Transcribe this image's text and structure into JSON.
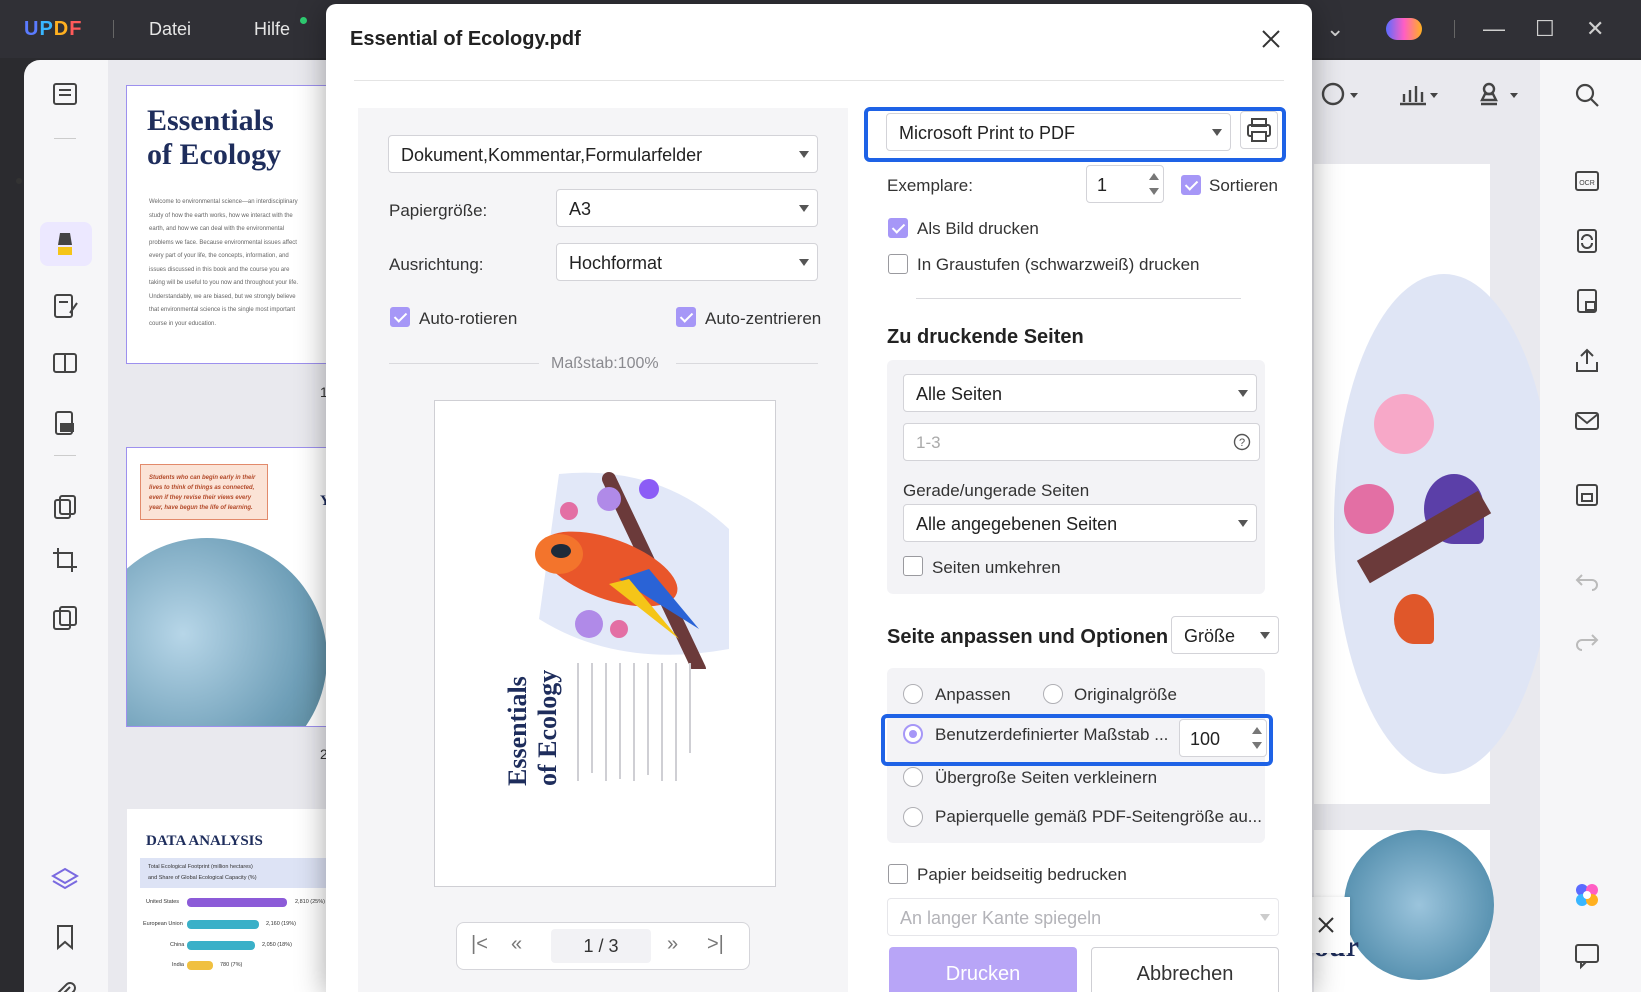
{
  "app": {
    "menu_file": "Datei",
    "menu_help": "Hilfe",
    "accent": "#a697f7",
    "highlight_color": "#1e62e6"
  },
  "background": {
    "thumb1_title_line1": "Essentials",
    "thumb1_title_line2": "of Ecology",
    "thumb1_body": "Welcome to environmental science—an interdisciplinary study of how the earth works, how we interact with the earth, and how we can deal with the environmental problems we face. Because environmental issues affect every part of your life, the concepts, information, and issues discussed in this book and the course you are taking will be useful to you now and throughout your life. Understandably, we are biased, but we strongly believe that environmental science is the single most important course in your education.",
    "page1": "1",
    "page2": "2",
    "callout": "Students who can begin early in their lives to think of things as connected, even if they revise their views every year, have begun the life of learning.",
    "thumb2_letter": "Y",
    "data_title": "DATA ANALYSIS",
    "data_legend_line1": "Total Ecological Footprint (million hectares)",
    "data_legend_line2": "and Share of Global Ecological Capacity (%)",
    "data_rows": [
      {
        "label": "United States",
        "value": "2,810 (25%)"
      },
      {
        "label": "European Union",
        "value": "2,160 (19%)"
      },
      {
        "label": "China",
        "value": "2,050 (18%)"
      },
      {
        "label": "India",
        "value": "780 (7%)"
      }
    ],
    "right_fragment": "our"
  },
  "dialog": {
    "title": "Essential of Ecology.pdf",
    "content_select": "Dokument,Kommentar,Formularfelder",
    "paper_size_label": "Papiergröße:",
    "paper_size_value": "A3",
    "orientation_label": "Ausrichtung:",
    "orientation_value": "Hochformat",
    "auto_rotate": "Auto-rotieren",
    "auto_center": "Auto-zentrieren",
    "scale_label": "Maßstab:100%",
    "preview_title_line1": "Essentials",
    "preview_title_line2": "of Ecology",
    "pager": {
      "current": "1",
      "separator": "/",
      "total": "3"
    },
    "printer": "Microsoft Print to PDF",
    "copies_label": "Exemplare:",
    "copies_value": "1",
    "sort_label": "Sortieren",
    "print_as_image": "Als Bild drucken",
    "grayscale": "In Graustufen (schwarzweiß) drucken",
    "pages_section": "Zu druckende Seiten",
    "pages_select": "Alle Seiten",
    "pages_range_placeholder": "1-3",
    "odd_even_label": "Gerade/ungerade Seiten",
    "odd_even_value": "Alle angegebenen Seiten",
    "reverse_pages": "Seiten umkehren",
    "fit_section": "Seite anpassen und Optionen",
    "fit_select": "Größe",
    "opt_fit": "Anpassen",
    "opt_original": "Originalgröße",
    "opt_custom": "Benutzerdefinierter Maßstab ...",
    "opt_custom_value": "100",
    "opt_shrink": "Übergroße Seiten verkleinern",
    "opt_paper_source": "Papierquelle gemäß PDF-Seitengröße au...",
    "duplex": "Papier beidseitig bedrucken",
    "duplex_mode": "An langer Kante spiegeln",
    "print_button": "Drucken",
    "cancel_button": "Abbrechen"
  }
}
